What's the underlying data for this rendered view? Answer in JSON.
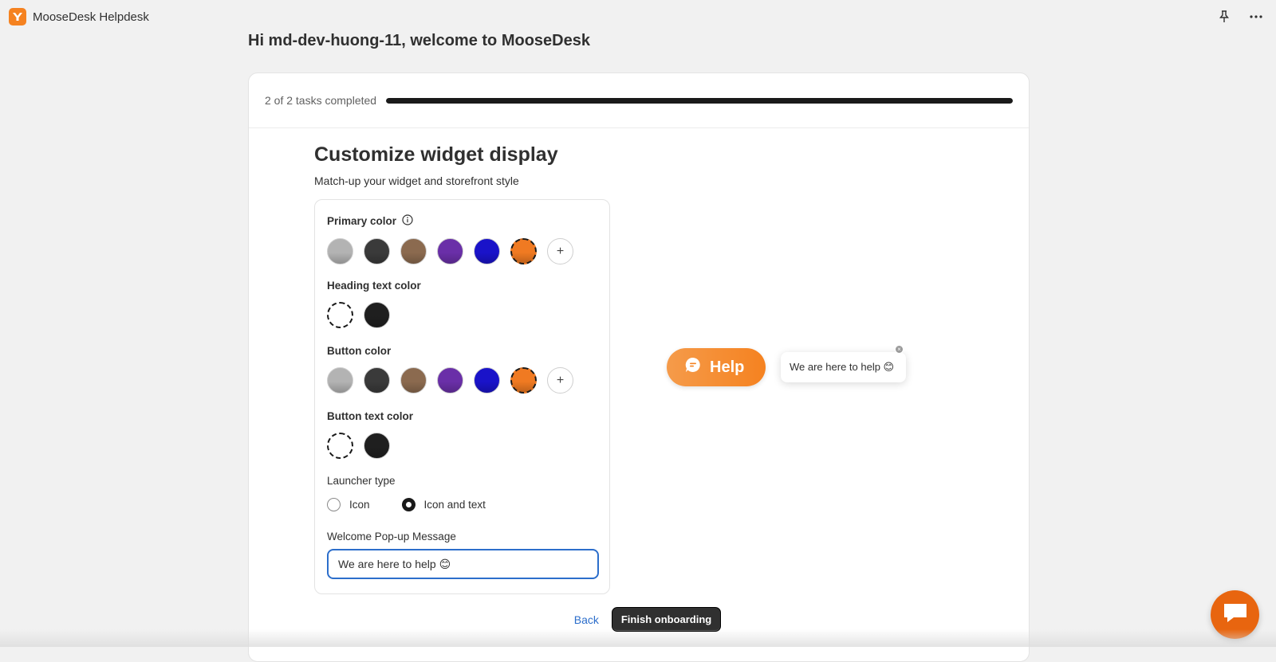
{
  "app": {
    "title": "MooseDesk Helpdesk",
    "logo_icon": "moosedesk-logo-icon",
    "brand_color": "#f58220"
  },
  "header": {
    "welcome": "Hi md-dev-huong-11, welcome to MooseDesk"
  },
  "progress": {
    "label": "2 of 2 tasks completed",
    "completed": 2,
    "total": 2,
    "fraction": 1.0
  },
  "step": {
    "title": "Customize widget display",
    "subtitle": "Match-up your widget and storefront style"
  },
  "settings": {
    "primary_color": {
      "label": "Primary color",
      "swatches": [
        "#b3b3b3",
        "#3a3a3a",
        "#8b6a4f",
        "#6a2fa8",
        "#1a13c9",
        "#f07a22"
      ],
      "selected_index": 5
    },
    "heading_text_color": {
      "label": "Heading text color",
      "swatches": [
        "#ffffff",
        "#1f1f1f"
      ],
      "selected_index": 0
    },
    "button_color": {
      "label": "Button color",
      "swatches": [
        "#b3b3b3",
        "#3a3a3a",
        "#8b6a4f",
        "#6a2fa8",
        "#1a13c9",
        "#f07a22"
      ],
      "selected_index": 5
    },
    "button_text_color": {
      "label": "Button text color",
      "swatches": [
        "#ffffff",
        "#1f1f1f"
      ],
      "selected_index": 0
    },
    "launcher_type": {
      "label": "Launcher type",
      "options": [
        "Icon",
        "Icon and text"
      ],
      "selected": "Icon and text"
    },
    "welcome_message": {
      "label": "Welcome Pop-up Message",
      "value": "We are here to help 😊"
    }
  },
  "preview": {
    "launcher_text": "Help",
    "bubble_text": "We are here to help 😊"
  },
  "actions": {
    "back": "Back",
    "finish": "Finish onboarding"
  }
}
